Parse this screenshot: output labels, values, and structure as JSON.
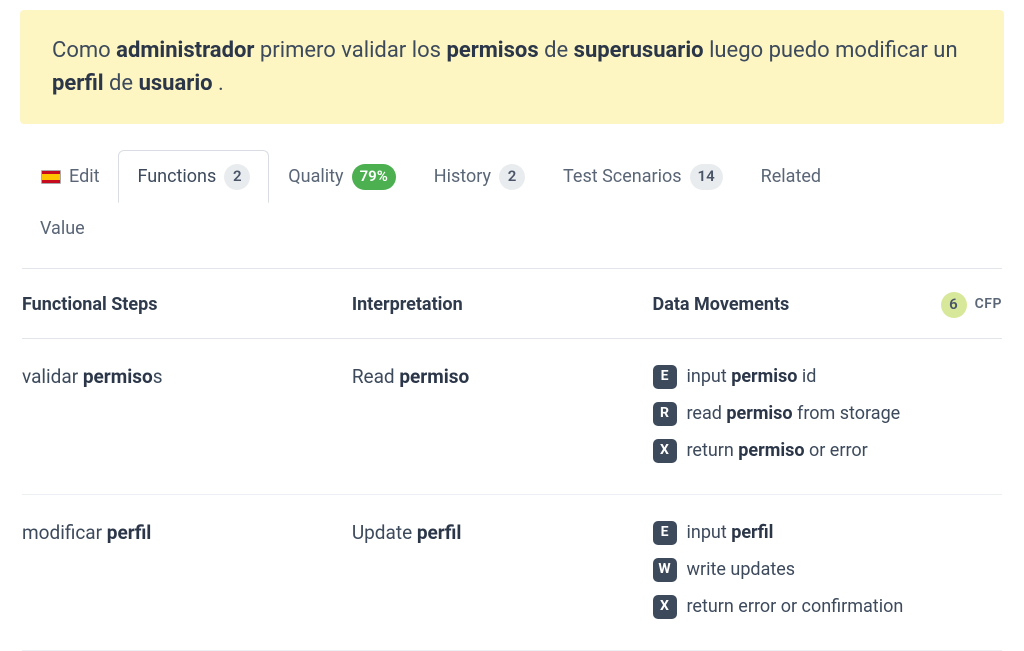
{
  "banner": {
    "segments": [
      {
        "text": "Como ",
        "bold": false
      },
      {
        "text": "administrador",
        "bold": true
      },
      {
        "text": " primero validar los ",
        "bold": false
      },
      {
        "text": "permisos",
        "bold": true
      },
      {
        "text": " de ",
        "bold": false
      },
      {
        "text": "superusuario",
        "bold": true
      },
      {
        "text": " luego puedo modificar un ",
        "bold": false
      },
      {
        "text": "perfil",
        "bold": true
      },
      {
        "text": " de ",
        "bold": false
      },
      {
        "text": "usuario",
        "bold": true
      },
      {
        "text": " .",
        "bold": false
      }
    ]
  },
  "tabs": [
    {
      "id": "edit",
      "label": "Edit",
      "flag": "es",
      "badge": null,
      "badgeStyle": null,
      "active": false
    },
    {
      "id": "functions",
      "label": "Functions",
      "flag": null,
      "badge": "2",
      "badgeStyle": "grey",
      "active": true
    },
    {
      "id": "quality",
      "label": "Quality",
      "flag": null,
      "badge": "79%",
      "badgeStyle": "green",
      "active": false
    },
    {
      "id": "history",
      "label": "History",
      "flag": null,
      "badge": "2",
      "badgeStyle": "grey",
      "active": false
    },
    {
      "id": "test-scenarios",
      "label": "Test Scenarios",
      "flag": null,
      "badge": "14",
      "badgeStyle": "grey",
      "active": false
    },
    {
      "id": "related",
      "label": "Related",
      "flag": null,
      "badge": null,
      "badgeStyle": null,
      "active": false
    }
  ],
  "secondRow": {
    "value_label": "Value"
  },
  "columns": {
    "functional_steps": "Functional Steps",
    "interpretation": "Interpretation",
    "data_movements": "Data Movements"
  },
  "cfp": {
    "count": "6",
    "label": "CFP"
  },
  "rows": [
    {
      "step_segments": [
        {
          "text": "validar ",
          "bold": false
        },
        {
          "text": "permiso",
          "bold": true
        },
        {
          "text": "s",
          "bold": false
        }
      ],
      "interp_segments": [
        {
          "text": "Read ",
          "bold": false
        },
        {
          "text": "permiso",
          "bold": true
        }
      ],
      "movements": [
        {
          "code": "E",
          "segments": [
            {
              "text": "input ",
              "bold": false
            },
            {
              "text": "permiso",
              "bold": true
            },
            {
              "text": " id",
              "bold": false
            }
          ]
        },
        {
          "code": "R",
          "segments": [
            {
              "text": "read ",
              "bold": false
            },
            {
              "text": "permiso",
              "bold": true
            },
            {
              "text": " from storage",
              "bold": false
            }
          ]
        },
        {
          "code": "X",
          "segments": [
            {
              "text": "return ",
              "bold": false
            },
            {
              "text": "permiso",
              "bold": true
            },
            {
              "text": " or error",
              "bold": false
            }
          ]
        }
      ]
    },
    {
      "step_segments": [
        {
          "text": "modificar ",
          "bold": false
        },
        {
          "text": "perfil",
          "bold": true
        }
      ],
      "interp_segments": [
        {
          "text": "Update ",
          "bold": false
        },
        {
          "text": "perfil",
          "bold": true
        }
      ],
      "movements": [
        {
          "code": "E",
          "segments": [
            {
              "text": "input ",
              "bold": false
            },
            {
              "text": "perfil",
              "bold": true
            }
          ]
        },
        {
          "code": "W",
          "segments": [
            {
              "text": "write updates",
              "bold": false
            }
          ]
        },
        {
          "code": "X",
          "segments": [
            {
              "text": "return error or confirmation",
              "bold": false
            }
          ]
        }
      ]
    }
  ]
}
